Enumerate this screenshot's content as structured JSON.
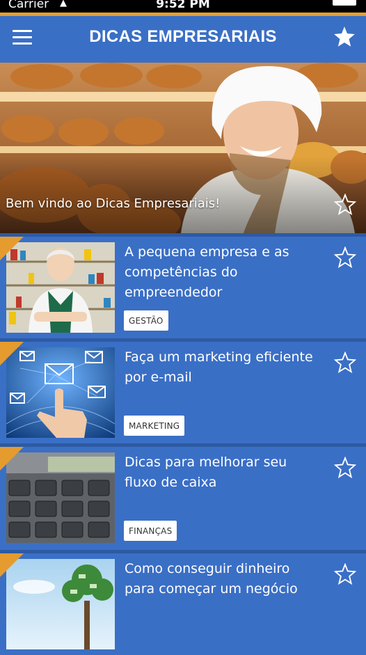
{
  "status_bar": {
    "carrier": "Carrier",
    "time": "9:52 PM"
  },
  "header": {
    "title": "DICAS EMPRESARIAIS"
  },
  "hero": {
    "caption": "Bem vindo ao Dicas Empresariais!"
  },
  "articles": [
    {
      "title": "A pequena empresa e as competências do empreendedor",
      "tag": "GESTÃO"
    },
    {
      "title": "Faça um marketing eficiente por e-mail",
      "tag": "MARKETING"
    },
    {
      "title": "Dicas para melhorar seu fluxo de caixa",
      "tag": "FINANÇAS"
    },
    {
      "title": "Como conseguir dinheiro para começar um negócio",
      "tag": ""
    }
  ],
  "colors": {
    "primary": "#3a6fc6",
    "accent": "#e59b2e",
    "divider": "#2d5aa3",
    "tag_background": "#ffffff"
  },
  "icons": [
    "menu-icon",
    "star-icon",
    "wifi-icon",
    "battery-icon"
  ]
}
